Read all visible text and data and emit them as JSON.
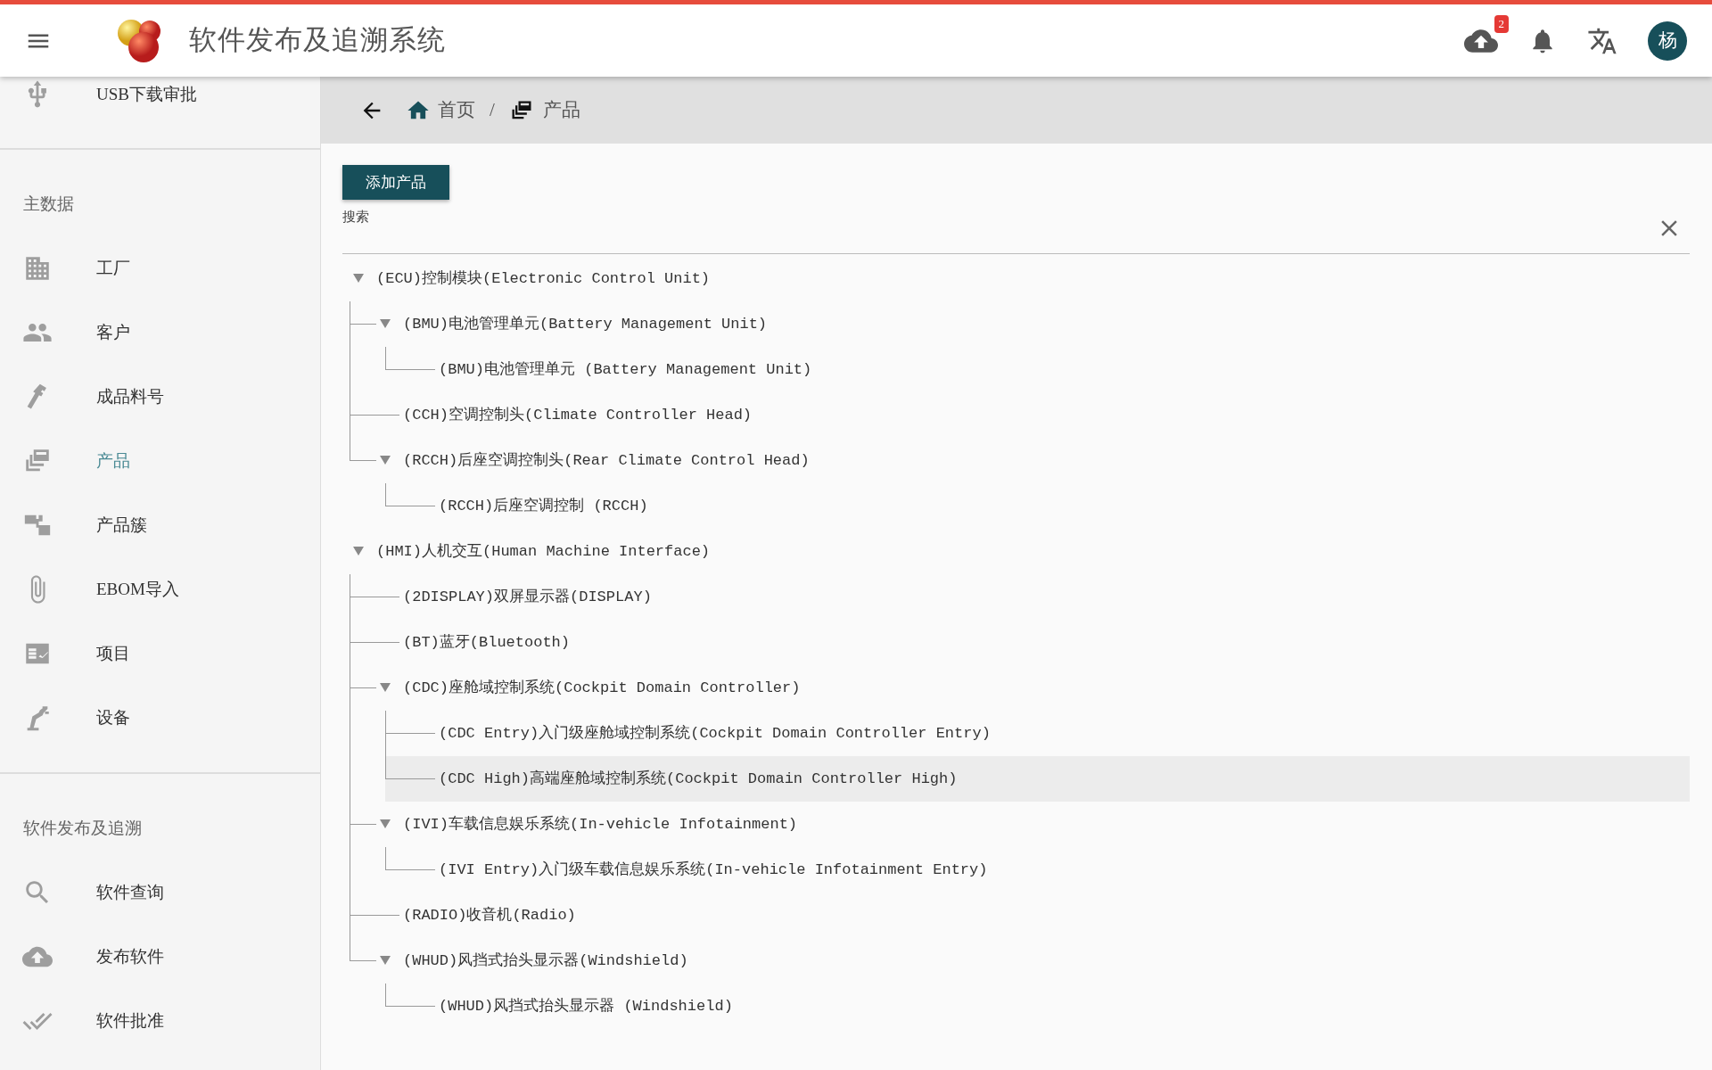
{
  "header": {
    "title": "软件发布及追溯系统",
    "upload_badge": "2",
    "avatar": "杨"
  },
  "sidebar": {
    "sections": [
      {
        "items": [
          {
            "label": "USB下载审批",
            "selected": false
          }
        ]
      },
      {
        "title": "主数据",
        "items": [
          {
            "label": "工厂",
            "selected": false
          },
          {
            "label": "客户",
            "selected": false
          },
          {
            "label": "成品料号",
            "selected": false
          },
          {
            "label": "产品",
            "selected": true
          },
          {
            "label": "产品簇",
            "selected": false
          },
          {
            "label": "EBOM导入",
            "selected": false
          },
          {
            "label": "项目",
            "selected": false
          },
          {
            "label": "设备",
            "selected": false
          }
        ]
      },
      {
        "title": "软件发布及追溯",
        "items": [
          {
            "label": "软件查询",
            "selected": false
          },
          {
            "label": "发布软件",
            "selected": false
          },
          {
            "label": "软件批准",
            "selected": false
          }
        ]
      }
    ]
  },
  "breadcrumb": {
    "items": [
      {
        "label": "首页"
      },
      {
        "label": "产品"
      }
    ],
    "separator": "/"
  },
  "add_button": "添加产品",
  "search": {
    "label": "搜索"
  },
  "tree": {
    "nodes": [
      {
        "label": "(ECU)控制模块(Electronic Control Unit)",
        "expanded": true,
        "highlighted": false,
        "children": [
          {
            "label": "(BMU)电池管理单元(Battery Management Unit)",
            "expanded": true,
            "highlighted": false,
            "children": [
              {
                "label": "(BMU)电池管理单元 (Battery Management Unit)",
                "highlighted": false
              }
            ]
          },
          {
            "label": "(CCH)空调控制头(Climate Controller Head)",
            "highlighted": false
          },
          {
            "label": "(RCCH)后座空调控制头(Rear Climate Control Head)",
            "expanded": true,
            "highlighted": false,
            "children": [
              {
                "label": "(RCCH)后座空调控制 (RCCH)",
                "highlighted": false
              }
            ]
          }
        ]
      },
      {
        "label": "(HMI)人机交互(Human Machine Interface)",
        "expanded": true,
        "highlighted": false,
        "children": [
          {
            "label": "(2DISPLAY)双屏显示器(DISPLAY)",
            "highlighted": false
          },
          {
            "label": "(BT)蓝牙(Bluetooth)",
            "highlighted": false
          },
          {
            "label": "(CDC)座舱域控制系统(Cockpit Domain Controller)",
            "expanded": true,
            "highlighted": false,
            "children": [
              {
                "label": "(CDC Entry)入门级座舱域控制系统(Cockpit Domain Controller Entry)",
                "highlighted": false
              },
              {
                "label": "(CDC High)高端座舱域控制系统(Cockpit Domain Controller High)",
                "highlighted": true
              }
            ]
          },
          {
            "label": "(IVI)车载信息娱乐系统(In-vehicle Infotainment)",
            "expanded": true,
            "highlighted": false,
            "children": [
              {
                "label": "(IVI Entry)入门级车载信息娱乐系统(In-vehicle Infotainment Entry)",
                "highlighted": false
              }
            ]
          },
          {
            "label": "(RADIO)收音机(Radio)",
            "highlighted": false
          },
          {
            "label": "(WHUD)风挡式抬头显示器(Windshield)",
            "expanded": true,
            "highlighted": false,
            "children": [
              {
                "label": "(WHUD)风挡式抬头显示器 (Windshield)",
                "highlighted": false
              }
            ]
          }
        ]
      }
    ]
  }
}
